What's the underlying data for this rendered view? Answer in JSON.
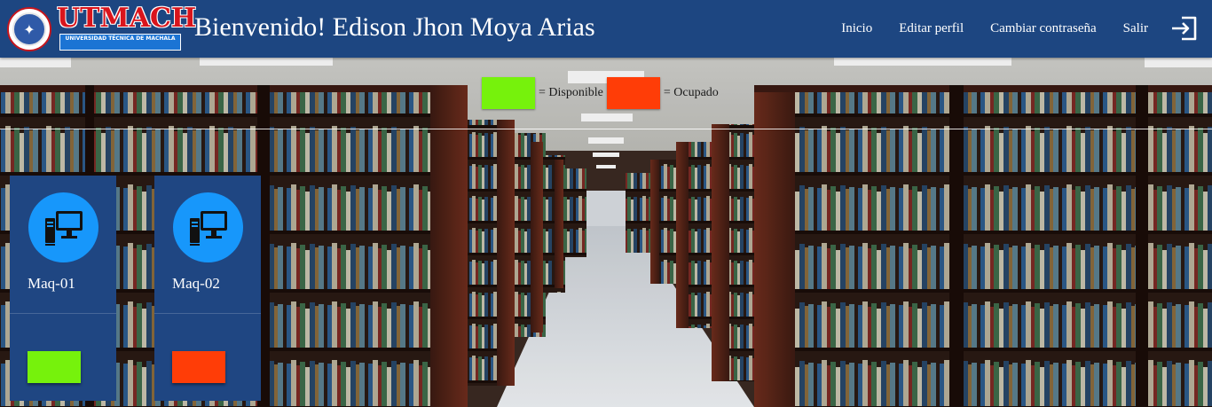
{
  "header": {
    "logo_text": "UTMACH",
    "logo_subtitle": "UNIVERSIDAD TÉCNICA DE MACHALA",
    "welcome": "Bienvenido! Edison Jhon Moya Arias",
    "nav": [
      {
        "label": "Inicio"
      },
      {
        "label": "Editar perfil"
      },
      {
        "label": "Cambiar contraseña"
      },
      {
        "label": "Salir"
      }
    ],
    "logout_icon": "sign-out-icon"
  },
  "legend": {
    "available_label": "= Disponible",
    "occupied_label": "= Ocupado",
    "available_color": "#76f20c",
    "occupied_color": "#ff3d07"
  },
  "machines": [
    {
      "name": "Maq-01",
      "status": "Disponible",
      "status_color": "#76f20c",
      "icon": "desktop-computer-icon"
    },
    {
      "name": "Maq-02",
      "status": "Ocupado",
      "status_color": "#ff3d07",
      "icon": "desktop-computer-icon"
    }
  ],
  "colors": {
    "navbar": "#1d4681",
    "card": "#1f4682",
    "icon_circle": "#1797fb"
  }
}
